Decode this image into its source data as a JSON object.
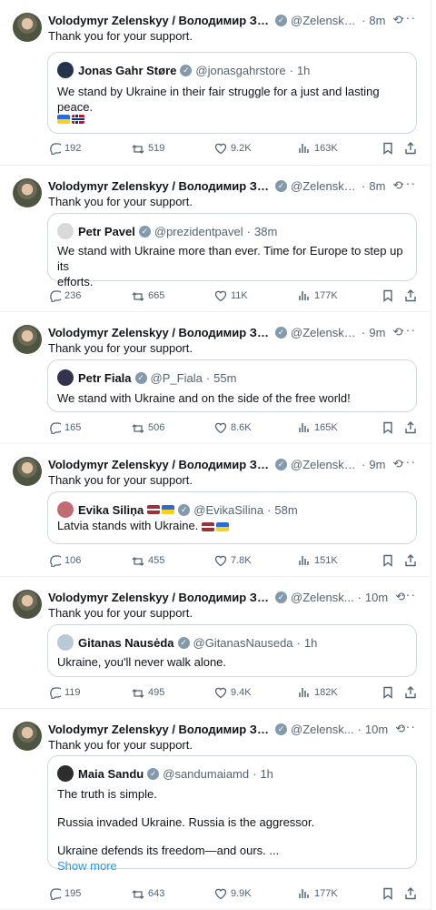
{
  "tweets": [
    {
      "author": "Volodymyr Zelenskyy / Володимир Зеле...",
      "handle": "@Zelensky...",
      "time": "8m",
      "text": "Thank you for your support.",
      "quote": {
        "name": "Jonas Gahr Støre",
        "handle": "@jonasgahrstore",
        "time": "1h",
        "lines": [
          "We stand by Ukraine in their fair struggle for a just and lasting peace."
        ],
        "flags": [
          "ua",
          "no"
        ]
      },
      "stats": {
        "replies": "192",
        "reposts": "519",
        "likes": "9.2K",
        "views": "163K"
      }
    },
    {
      "author": "Volodymyr Zelenskyy / Володимир Зеле...",
      "handle": "@Zelensky...",
      "time": "8m",
      "text": "Thank you for your support.",
      "quote": {
        "name": "Petr Pavel",
        "handle": "@prezidentpavel",
        "time": "38m",
        "lines": [
          "We stand with Ukraine more than ever. Time for Europe to step up its",
          "efforts."
        ]
      },
      "stats": {
        "replies": "236",
        "reposts": "665",
        "likes": "11K",
        "views": "177K"
      }
    },
    {
      "author": "Volodymyr Zelenskyy / Володимир Зеле...",
      "handle": "@Zelensky...",
      "time": "9m",
      "text": "Thank you for your support.",
      "quote": {
        "name": "Petr Fiala",
        "handle": "@P_Fiala",
        "time": "55m",
        "lines": [
          "We stand with Ukraine and on the side of the free world!"
        ]
      },
      "stats": {
        "replies": "165",
        "reposts": "506",
        "likes": "8.6K",
        "views": "165K"
      }
    },
    {
      "author": "Volodymyr Zelenskyy / Володимир Зеле...",
      "handle": "@Zelensky...",
      "time": "9m",
      "text": "Thank you for your support.",
      "quote": {
        "name": "Evika Siliņa",
        "handle": "@EvikaSilina",
        "time": "58m",
        "lines": [
          "Latvia stands with Ukraine."
        ]
      },
      "stats": {
        "replies": "106",
        "reposts": "455",
        "likes": "7.8K",
        "views": "151K"
      }
    },
    {
      "author": "Volodymyr Zelenskyy / Володимир Зел...",
      "handle": "@Zelensk...",
      "time": "10m",
      "text": "Thank you for your support.",
      "quote": {
        "name": "Gitanas Nausėda",
        "handle": "@GitanasNauseda",
        "time": "1h",
        "lines": [
          "Ukraine, you'll never walk alone."
        ]
      },
      "stats": {
        "replies": "119",
        "reposts": "495",
        "likes": "9.4K",
        "views": "182K"
      }
    },
    {
      "author": "Volodymyr Zelenskyy / Володимир Зел...",
      "handle": "@Zelensk...",
      "time": "10m",
      "text": "Thank you for your support.",
      "quote": {
        "name": "Maia Sandu",
        "handle": "@sandumaiamd",
        "time": "1h",
        "lines": [
          "The truth is simple.",
          "",
          "Russia invaded Ukraine. Russia is the aggressor.",
          "",
          "Ukraine defends its freedom—and ours. ..."
        ],
        "show_more": "Show more"
      },
      "stats": {
        "replies": "195",
        "reposts": "643",
        "likes": "9.9K",
        "views": "177K"
      }
    }
  ]
}
